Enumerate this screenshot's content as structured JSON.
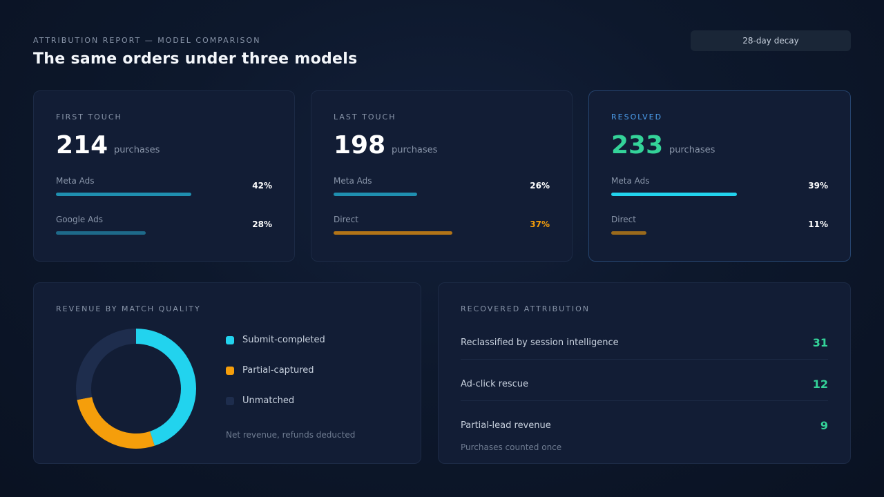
{
  "header": {
    "eyebrow": "ATTRIBUTION REPORT — MODEL COMPARISON",
    "title": "The same orders under three models",
    "decay_button": "28-day decay"
  },
  "models": [
    {
      "label": "FIRST TOUCH",
      "value": "214",
      "unit": "purchases",
      "rows": [
        {
          "label": "Meta Ads",
          "pct": "42%",
          "fill": 0.42,
          "color": "#1f8fb0"
        },
        {
          "label": "Google Ads",
          "pct": "28%",
          "fill": 0.28,
          "color": "#1e6a8a"
        }
      ]
    },
    {
      "label": "LAST TOUCH",
      "value": "198",
      "unit": "purchases",
      "rows": [
        {
          "label": "Meta Ads",
          "pct": "26%",
          "fill": 0.26,
          "color": "#1f8fb0"
        },
        {
          "label": "Direct",
          "pct": "37%",
          "fill": 0.37,
          "color": "#b27417"
        }
      ]
    },
    {
      "label": "RESOLVED",
      "value": "233",
      "unit": "purchases",
      "rows": [
        {
          "label": "Meta Ads",
          "pct": "39%",
          "fill": 0.39,
          "color": "#22d3ee"
        },
        {
          "label": "Direct",
          "pct": "11%",
          "fill": 0.11,
          "color": "#9a6a1c"
        }
      ]
    }
  ],
  "revenue": {
    "label": "REVENUE BY MATCH QUALITY",
    "legend": [
      {
        "label": "Submit-completed",
        "color": "#22d3ee"
      },
      {
        "label": "Partial-captured",
        "color": "#f59e0b"
      },
      {
        "label": "Unmatched",
        "color": "#1e2d4d"
      }
    ],
    "shares": [
      0.45,
      0.27,
      0.28
    ],
    "note": "Net revenue, refunds deducted"
  },
  "recovered": {
    "label": "RECOVERED ATTRIBUTION",
    "rows": [
      {
        "label": "Reclassified by session intelligence",
        "value": "31"
      },
      {
        "label": "Ad-click rescue",
        "value": "12"
      },
      {
        "label": "Partial-lead revenue",
        "value": "9"
      }
    ],
    "note": "Purchases counted once"
  }
}
